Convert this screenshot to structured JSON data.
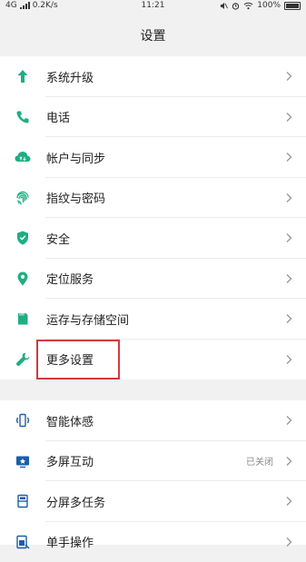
{
  "status_bar": {
    "network": "4G",
    "speed": "0.2K/s",
    "time": "11:21",
    "battery": "100%"
  },
  "header": {
    "title": "设置"
  },
  "colors": {
    "accent": "#1fae82",
    "highlight": "#d43a3a",
    "chevron": "#9a9a9a"
  },
  "group1": [
    {
      "label": "系统升级",
      "icon": "arrow-up-icon"
    },
    {
      "label": "电话",
      "icon": "phone-icon"
    },
    {
      "label": "帐户与同步",
      "icon": "cloud-sync-icon"
    },
    {
      "label": "指纹与密码",
      "icon": "fingerprint-icon"
    },
    {
      "label": "安全",
      "icon": "shield-icon"
    },
    {
      "label": "定位服务",
      "icon": "location-pin-icon"
    },
    {
      "label": "运存与存储空间",
      "icon": "sd-card-icon"
    },
    {
      "label": "更多设置",
      "icon": "wrench-icon"
    }
  ],
  "group2": [
    {
      "label": "智能体感",
      "icon": "phone-vibrate-icon"
    },
    {
      "label": "多屏互动",
      "icon": "cast-screen-icon",
      "value": "已关闭"
    },
    {
      "label": "分屏多任务",
      "icon": "split-screen-icon"
    },
    {
      "label": "单手操作",
      "icon": "one-hand-icon"
    }
  ]
}
